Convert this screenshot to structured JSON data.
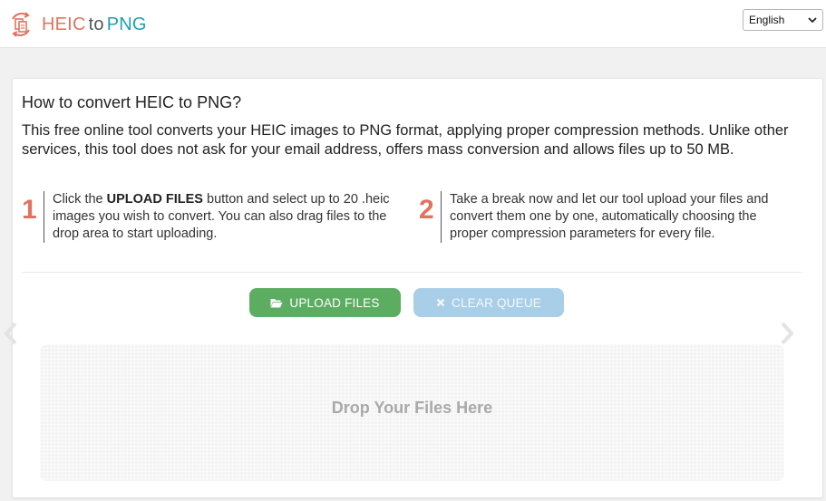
{
  "header": {
    "logo": {
      "part1": "HEIC",
      "part2": "to",
      "part3": "PNG"
    },
    "language": {
      "selected": "English"
    }
  },
  "main": {
    "title": "How to convert HEIC to PNG?",
    "intro": "This free online tool converts your HEIC images to PNG format, applying proper compression methods. Unlike other services, this tool does not ask for your email address, offers mass conversion and allows files up to 50 MB.",
    "steps": [
      {
        "number": "1",
        "pre": "Click the ",
        "bold": "UPLOAD FILES",
        "post": " button and select up to 20 .heic images you wish to convert. You can also drag files to the drop area to start uploading."
      },
      {
        "number": "2",
        "text": "Take a break now and let our tool upload your files and convert them one by one, automatically choosing the proper compression parameters for every file."
      }
    ],
    "buttons": {
      "upload": "UPLOAD FILES",
      "clear": "CLEAR QUEUE"
    },
    "dropzone": "Drop Your Files Here"
  },
  "colors": {
    "accent_orange": "#e0735f",
    "accent_teal": "#1ea0b3",
    "upload_green": "#5cad62",
    "clear_blue": "#a9cfe8"
  },
  "icons": [
    "convert-files-icon",
    "chevron-down-icon",
    "folder-open-icon",
    "close-icon",
    "chevron-left-icon",
    "chevron-right-icon"
  ]
}
